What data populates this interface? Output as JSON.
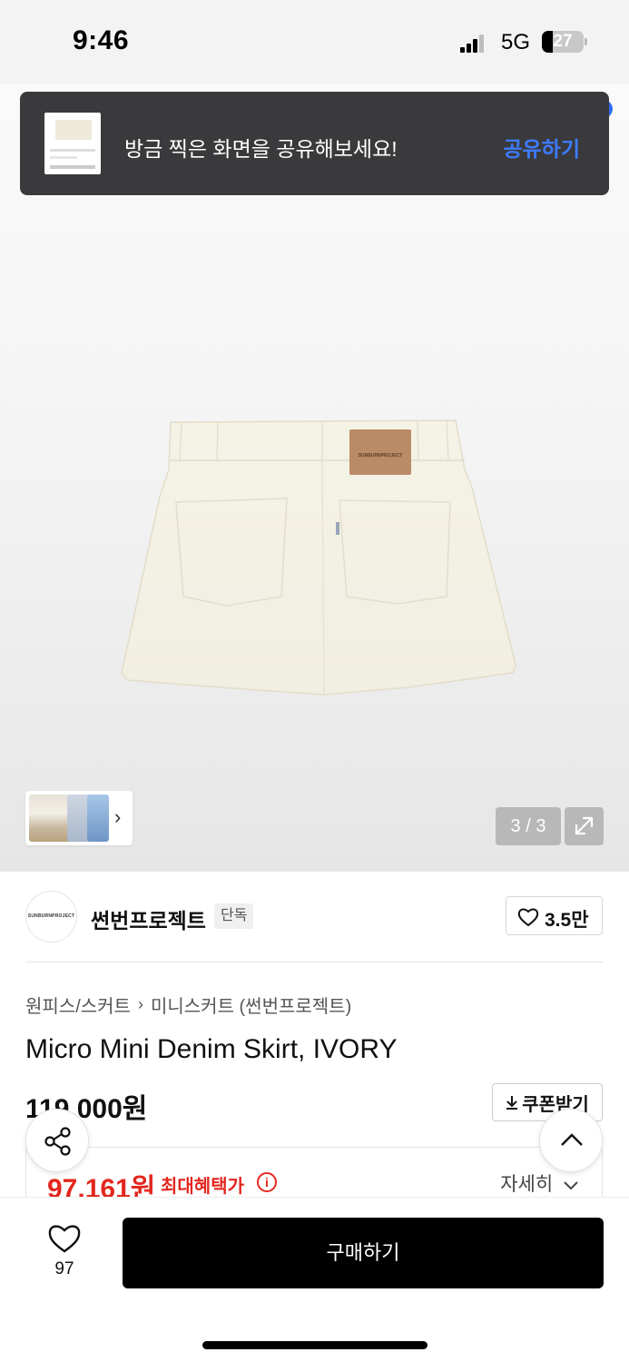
{
  "status_bar": {
    "time": "9:46",
    "network": "5G",
    "battery": "27",
    "battery_level_percent": 27
  },
  "toast": {
    "message": "방금 찍은 화면을 공유해보세요!",
    "action_label": "공유하기",
    "action_color": "#3d7bff"
  },
  "gallery": {
    "page_indicator": "3 / 3",
    "current_page": 3,
    "total_pages": 3,
    "expand_icon": "expand-icon",
    "thumbnail_chevron_icon": "chevron-right-icon"
  },
  "brand": {
    "logo_text": "SUNBURNPROJECT",
    "name": "썬번프로젝트",
    "badge": "단독",
    "like_count": "3.5만",
    "like_icon": "heart-outline-icon"
  },
  "product": {
    "breadcrumb": [
      "원피스/스커트",
      "미니스커트 (썬번프로젝트)"
    ],
    "name": "Micro Mini Denim Skirt, IVORY",
    "price": "119,000원",
    "coupon_label": "쿠폰받기",
    "coupon_icon": "download-icon"
  },
  "benefit": {
    "price": "97,161원",
    "label": "최대혜택가",
    "detail_label": "자세히",
    "accent_color": "#e3271f"
  },
  "floating": {
    "share_icon": "share-icon",
    "top_icon": "chevron-up-icon"
  },
  "bottom_bar": {
    "wish_count": "97",
    "buy_label": "구매하기",
    "wish_icon": "heart-outline-icon"
  }
}
